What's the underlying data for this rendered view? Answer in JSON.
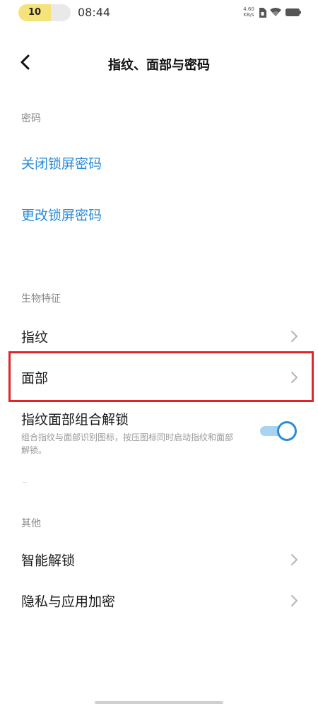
{
  "status_bar": {
    "notification_count": "10",
    "time": "08:44",
    "net_speed_value": "4.60",
    "net_speed_unit": "KB/s"
  },
  "header": {
    "title": "指纹、面部与密码"
  },
  "sections": {
    "password": {
      "header": "密码",
      "links": [
        "关闭锁屏密码",
        "更改锁屏密码"
      ]
    },
    "biometrics": {
      "header": "生物特征",
      "items": [
        "指纹",
        "面部"
      ],
      "combo_unlock": {
        "title": "指纹面部组合解锁",
        "description": "组合指纹与面部识别图标，按压图标同时启动指纹和面部解锁。",
        "enabled": true
      }
    },
    "other": {
      "header": "其他",
      "items": [
        "智能解锁",
        "隐私与应用加密"
      ]
    }
  },
  "colors": {
    "accent": "#2a8cd8",
    "highlight": "#e0262b",
    "notification_pill": "#f4e37a"
  }
}
